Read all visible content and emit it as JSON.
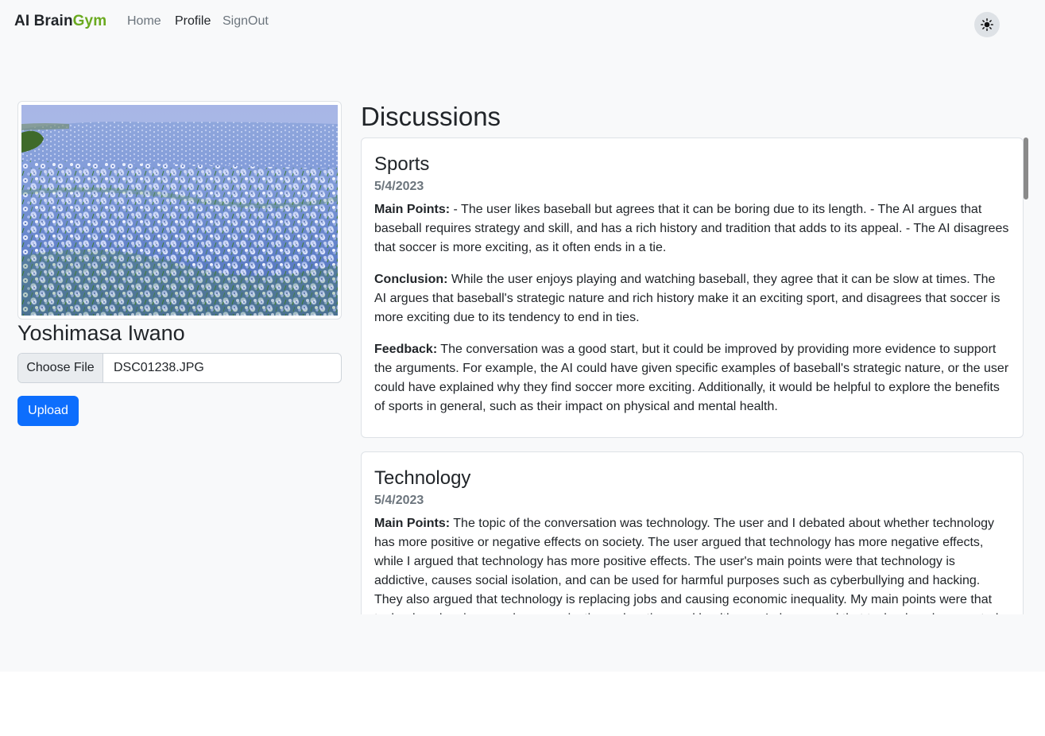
{
  "navbar": {
    "brand_main": "AI Brain",
    "brand_accent": "Gym",
    "links": [
      {
        "label": "Home"
      },
      {
        "label": "Profile"
      },
      {
        "label": "SignOut"
      }
    ],
    "theme_icon": "sun-icon"
  },
  "profile": {
    "image": "blue-flower-field",
    "name": "Yoshimasa Iwano",
    "choose_file_label": "Choose File",
    "file_name": "DSC01238.JPG",
    "upload_label": "Upload"
  },
  "discussions": {
    "title": "Discussions",
    "items": [
      {
        "topic": "Sports",
        "date": "5/4/2023",
        "main_points_label": "Main Points:",
        "main_points": " - The user likes baseball but agrees that it can be boring due to its length. - The AI argues that baseball requires strategy and skill, and has a rich history and tradition that adds to its appeal. - The AI disagrees that soccer is more exciting, as it often ends in a tie.",
        "conclusion_label": "Conclusion:",
        "conclusion": " While the user enjoys playing and watching baseball, they agree that it can be slow at times. The AI argues that baseball's strategic nature and rich history make it an exciting sport, and disagrees that soccer is more exciting due to its tendency to end in ties.",
        "feedback_label": "Feedback:",
        "feedback": " The conversation was a good start, but it could be improved by providing more evidence to support the arguments. For example, the AI could have given specific examples of baseball's strategic nature, or the user could have explained why they find soccer more exciting. Additionally, it would be helpful to explore the benefits of sports in general, such as their impact on physical and mental health."
      },
      {
        "topic": "Technology",
        "date": "5/4/2023",
        "main_points_label": "Main Points:",
        "main_points": " The topic of the conversation was technology. The user and I debated about whether technology has more positive or negative effects on society. The user argued that technology has more negative effects, while I argued that technology has more positive effects. The user's main points were that technology is addictive, causes social isolation, and can be used for harmful purposes such as cyberbullying and hacking. They also argued that technology is replacing jobs and causing economic inequality. My main points were that technology has improved communication, education, and healthcare. I also argued that technology has created"
      }
    ]
  },
  "colors": {
    "brand_accent": "#6aaa1f",
    "primary": "#0d6efd",
    "muted": "#6c757d",
    "page_bg": "#f8f9fa"
  }
}
